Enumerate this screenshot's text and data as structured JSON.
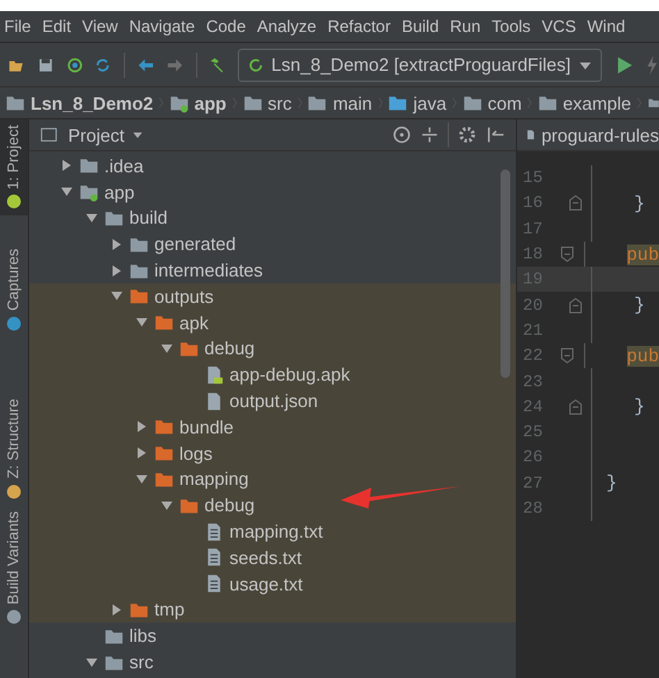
{
  "menu": [
    "File",
    "Edit",
    "View",
    "Navigate",
    "Code",
    "Analyze",
    "Refactor",
    "Build",
    "Run",
    "Tools",
    "VCS",
    "Wind"
  ],
  "toolbar": {
    "run_config": "Lsn_8_Demo2 [extractProguardFiles]"
  },
  "breadcrumbs": [
    {
      "label": "Lsn_8_Demo2",
      "kind": "project"
    },
    {
      "label": "app",
      "kind": "module"
    },
    {
      "label": "src",
      "kind": "folder"
    },
    {
      "label": "main",
      "kind": "folder"
    },
    {
      "label": "java",
      "kind": "source"
    },
    {
      "label": "com",
      "kind": "package"
    },
    {
      "label": "example",
      "kind": "package"
    }
  ],
  "side_tabs": [
    {
      "label": "1: Project",
      "selected": true
    },
    {
      "label": "Captures",
      "selected": false
    },
    {
      "label": "Z: Structure",
      "selected": false
    },
    {
      "label": "Build Variants",
      "selected": false
    }
  ],
  "project_panel": {
    "title": "Project",
    "tree": [
      {
        "label": ".idea",
        "kind": "folder",
        "expanded": false
      },
      {
        "label": "app",
        "kind": "module",
        "expanded": true,
        "children": [
          {
            "label": "build",
            "kind": "folder",
            "expanded": true,
            "children": [
              {
                "label": "generated",
                "kind": "folder",
                "expanded": false
              },
              {
                "label": "intermediates",
                "kind": "folder",
                "expanded": false
              },
              {
                "label": "outputs",
                "kind": "excluded",
                "expanded": true,
                "children": [
                  {
                    "label": "apk",
                    "kind": "excluded",
                    "expanded": true,
                    "children": [
                      {
                        "label": "debug",
                        "kind": "excluded",
                        "expanded": true,
                        "children": [
                          {
                            "label": "app-debug.apk",
                            "kind": "apk"
                          },
                          {
                            "label": "output.json",
                            "kind": "json"
                          }
                        ]
                      }
                    ]
                  },
                  {
                    "label": "bundle",
                    "kind": "excluded",
                    "expanded": false
                  },
                  {
                    "label": "logs",
                    "kind": "excluded",
                    "expanded": false
                  },
                  {
                    "label": "mapping",
                    "kind": "excluded",
                    "expanded": true,
                    "children": [
                      {
                        "label": "debug",
                        "kind": "excluded",
                        "expanded": true,
                        "children": [
                          {
                            "label": "mapping.txt",
                            "kind": "text"
                          },
                          {
                            "label": "seeds.txt",
                            "kind": "text"
                          },
                          {
                            "label": "usage.txt",
                            "kind": "text"
                          }
                        ]
                      }
                    ]
                  }
                ]
              },
              {
                "label": "tmp",
                "kind": "excluded",
                "expanded": false
              }
            ]
          },
          {
            "label": "libs",
            "kind": "folder"
          },
          {
            "label": "src",
            "kind": "folder",
            "expanded": true
          }
        ]
      }
    ]
  },
  "editor": {
    "tab": "proguard-rules",
    "lines": [
      {
        "number": "15",
        "fold_start": false,
        "fold_end": false,
        "current": false
      },
      {
        "number": "16",
        "text": "}",
        "fold_start": false,
        "fold_end": true,
        "current": false
      },
      {
        "number": "17",
        "fold_start": false,
        "fold_end": false,
        "current": false
      },
      {
        "number": "18",
        "text": "pub",
        "fold_start": true,
        "fold_end": false,
        "current": false
      },
      {
        "number": "19",
        "fold_start": false,
        "fold_end": false,
        "current": true
      },
      {
        "number": "20",
        "text": "}",
        "fold_start": false,
        "fold_end": true,
        "current": false
      },
      {
        "number": "21",
        "fold_start": false,
        "fold_end": false,
        "current": false
      },
      {
        "number": "22",
        "text": "pub",
        "fold_start": true,
        "fold_end": false,
        "current": false
      },
      {
        "number": "23",
        "fold_start": false,
        "fold_end": false,
        "current": false
      },
      {
        "number": "24",
        "text": "}",
        "fold_start": false,
        "fold_end": true,
        "current": false
      },
      {
        "number": "25",
        "fold_start": false,
        "fold_end": false,
        "current": false
      },
      {
        "number": "26",
        "fold_start": false,
        "fold_end": false,
        "current": false
      },
      {
        "number": "27",
        "text": "}",
        "fold_start": false,
        "fold_end": false,
        "current": false
      },
      {
        "number": "28",
        "fold_start": false,
        "fold_end": false,
        "current": false
      }
    ]
  }
}
